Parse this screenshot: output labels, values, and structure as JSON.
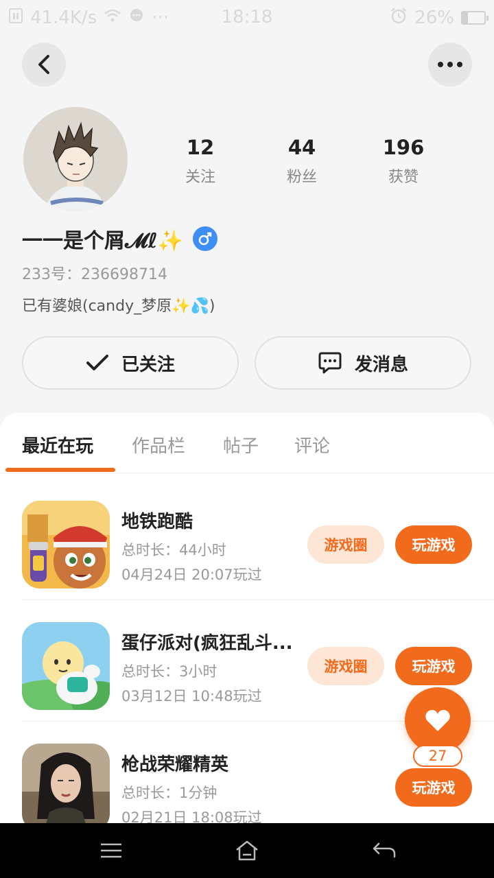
{
  "status_bar": {
    "speed": "41.4K/s",
    "dots": "···",
    "time": "18:18",
    "battery": "26%",
    "battery_level": 0.26
  },
  "profile": {
    "stats": [
      {
        "value": "12",
        "label": "关注"
      },
      {
        "value": "44",
        "label": "粉丝"
      },
      {
        "value": "196",
        "label": "获赞"
      }
    ],
    "nickname": "一一是个屑𝓜ℓ✨",
    "gender_symbol": "♂",
    "uid": "233号：236698714",
    "bio": "已有婆娘(candy_梦原✨💦)"
  },
  "actions": {
    "followed_label": "已关注",
    "message_label": "发消息"
  },
  "tabs": [
    {
      "label": "最近在玩",
      "active": true
    },
    {
      "label": "作品栏",
      "active": false
    },
    {
      "label": "帖子",
      "active": false
    },
    {
      "label": "评论",
      "active": false
    }
  ],
  "games": [
    {
      "name": "地铁跑酷",
      "duration": "总时长：44小时",
      "last_played": "04月24日 20:07玩过",
      "circle_label": "游戏圈",
      "play_label": "玩游戏"
    },
    {
      "name": "蛋仔派对(疯狂乱斗...",
      "duration": "总时长：3小时",
      "last_played": "03月12日 10:48玩过",
      "circle_label": "游戏圈",
      "play_label": "玩游戏"
    },
    {
      "name": "枪战荣耀精英",
      "duration": "总时长：1分钟",
      "last_played": "02月21日 18:08玩过",
      "circle_label": "",
      "play_label": "玩游戏"
    }
  ],
  "like_fab": {
    "count": "27"
  },
  "colors": {
    "accent": "#f26b1d",
    "accent_light": "#fde6d6",
    "gender_blue": "#3d8ff5"
  }
}
